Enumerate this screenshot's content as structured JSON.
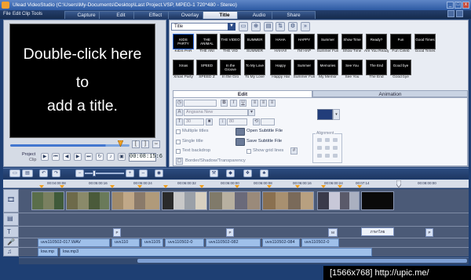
{
  "window": {
    "title": "Ulead VideoStudio (C:\\Users\\My-Documents\\Desktop\\Last Project.VSP, MPEG-1 720*480 - Stereo)",
    "controls": [
      "_",
      "□",
      "x"
    ]
  },
  "menu": [
    "File",
    "Edit",
    "Clip",
    "Tools"
  ],
  "steps": [
    "Capture",
    "Edit",
    "Effect",
    "Overlay",
    "Title",
    "Audio",
    "Share"
  ],
  "active_step": "Title",
  "preview": {
    "lines": [
      "Double-click here",
      "to",
      "add a title."
    ],
    "mode_project": "Project",
    "mode_clip": "Clip",
    "timecode": "00:08:15:6",
    "trim_in": "[",
    "trim_out": "]"
  },
  "gallery": {
    "category": "Title",
    "thumbnails": [
      {
        "label": "KIDS PAR",
        "art": "KIDS PARTY"
      },
      {
        "label": "THE ANI",
        "art": "THE ANIMAL"
      },
      {
        "label": "THE VID",
        "art": "THE VIDEO"
      },
      {
        "label": "SUMMER",
        "art": "SUMMER"
      },
      {
        "label": "HAHA!!",
        "art": "HAHA"
      },
      {
        "label": "I'M HAP",
        "art": "HAPPY"
      },
      {
        "label": "Summer Fun",
        "art": "Summer"
      },
      {
        "label": "Show Time",
        "art": "Show Time"
      },
      {
        "label": "Are You Ready?",
        "art": "Ready?"
      },
      {
        "label": "Fun Celeb",
        "art": "Fun"
      },
      {
        "label": "Good Times",
        "art": "Good Times"
      },
      {
        "label": "Xmas Party",
        "art": "Xmas"
      },
      {
        "label": "SPEED Z",
        "art": "SPEED"
      },
      {
        "label": "In the Gro",
        "art": "In the Groove"
      },
      {
        "label": "To My Love",
        "art": "To My Love"
      },
      {
        "label": "Happy Hal",
        "art": "Happy"
      },
      {
        "label": "Summer Fun",
        "art": "Summer"
      },
      {
        "label": "My Memor",
        "art": "Memories"
      },
      {
        "label": "See You",
        "art": "See You"
      },
      {
        "label": "The End",
        "art": "The End"
      },
      {
        "label": "Good bye",
        "art": "Good bye"
      }
    ]
  },
  "options": {
    "tabs": [
      "Edit",
      "Animation"
    ],
    "font": "Angsana New",
    "font_size": "30",
    "line_spacing": "80",
    "multiple_titles": "Multiple titles",
    "single_title": "Single title",
    "text_backdrop": "Text backdrop",
    "open_subtitle": "Open Subtitle File",
    "save_subtitle": "Save Subtitle File",
    "show_grid": "Show grid lines",
    "border_shadow": "Border/Shadow/Transparency",
    "alignment": "Alignment",
    "style_buttons": [
      "B",
      "I",
      "U"
    ]
  },
  "timeline": {
    "ticks": [
      "00:00:00:00",
      "00:04:00:08",
      "00:05:00:16",
      "00:05:00:24",
      "00:06:00:32",
      "00:06:00:00",
      "00:06:00:08",
      "00:06:00:16",
      "00:06:00:24",
      "00:07:00:32",
      "00:07:14",
      "00:08:00:00"
    ],
    "title_blocks": [
      "P",
      "P",
      "M",
      "P",
      "ภาษาไทย"
    ],
    "voice_clips": [
      "uvs110502-017.WAV",
      "uvs110",
      "uvs1105",
      "uvs110502-0",
      "uvs110502-082",
      "uvs110502-084",
      "uvs110502-0"
    ],
    "music_clips": [
      "low.mp",
      "low.mp3"
    ],
    "track_icons": [
      "film-strip",
      "overlay",
      "T",
      "mic",
      "music-note"
    ]
  },
  "watermark": "[1566x768] http://upic.me/",
  "colors": {
    "accent": "#2f6de0",
    "app_bg": "#1e3f73",
    "track": "#4b5a77",
    "audio_clip": "#9fc0ea",
    "title_color": "#223d7a"
  }
}
